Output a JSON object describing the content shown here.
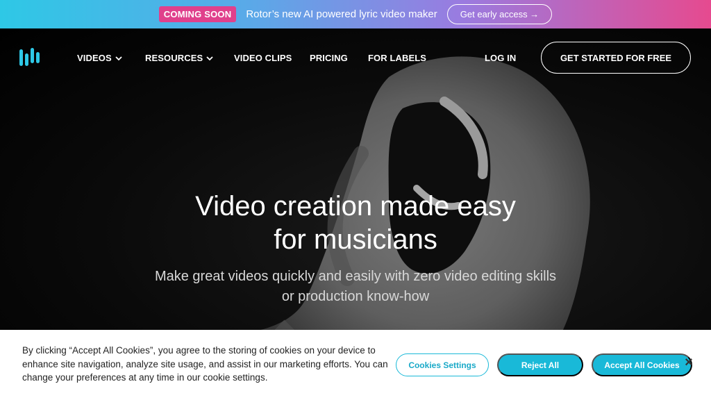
{
  "announcement": {
    "badge": "COMING SOON",
    "text": "Rotor’s new AI powered lyric video maker",
    "button": "Get early access →"
  },
  "nav": {
    "items": [
      {
        "label": "VIDEOS",
        "has_dropdown": true
      },
      {
        "label": "RESOURCES",
        "has_dropdown": true
      },
      {
        "label": "VIDEO CLIPS",
        "has_dropdown": false
      },
      {
        "label": "PRICING",
        "has_dropdown": false
      },
      {
        "label": "FOR LABELS",
        "has_dropdown": false
      }
    ],
    "login": "LOG IN",
    "cta": "GET STARTED FOR FREE"
  },
  "hero": {
    "headline_line1": "Video creation made easy",
    "headline_line2": "for musicians",
    "sub_line1": "Make great videos quickly and easily with zero video editing skills",
    "sub_line2": "or production know-how"
  },
  "cookie": {
    "text": "By clicking “Accept All Cookies”, you agree to the storing of cookies on your device to enhance site navigation, analyze site usage, and assist in our marketing efforts. You can change your preferences at any time in our cookie settings.",
    "settings_label": "Cookies Settings",
    "reject_label": "Reject All",
    "accept_label": "Accept All Cookies",
    "close_label": "×"
  },
  "colors": {
    "accent": "#19b9d8",
    "badge": "#e0408c"
  }
}
